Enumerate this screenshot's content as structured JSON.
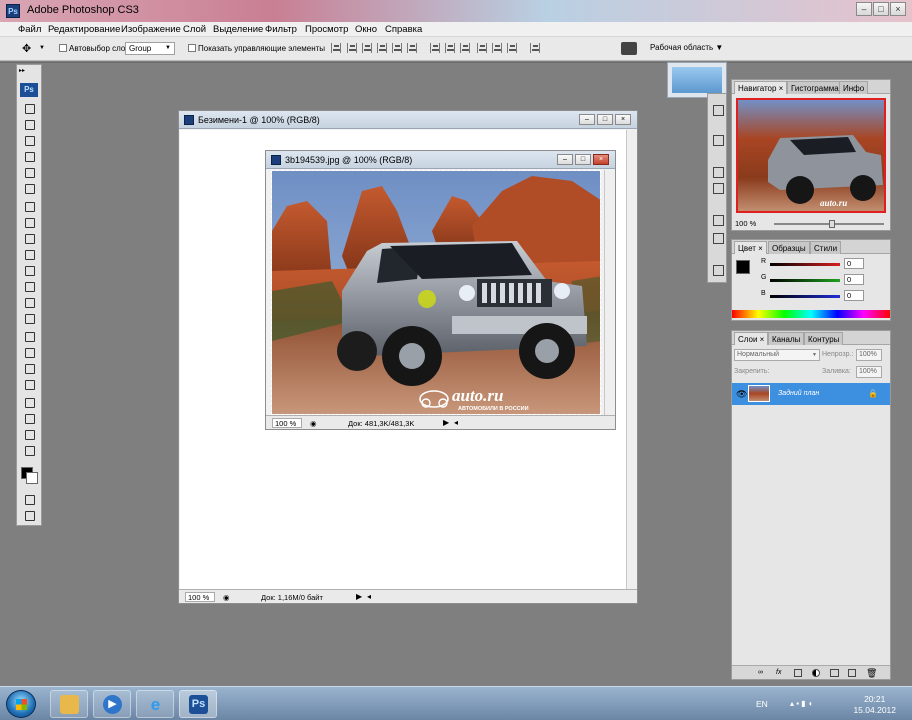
{
  "app": {
    "title": "Adobe Photoshop CS3",
    "icon_label": "Ps"
  },
  "menu": [
    "Файл",
    "Редактирование",
    "Изображение",
    "Слой",
    "Выделение",
    "Фильтр",
    "Просмотр",
    "Окно",
    "Справка"
  ],
  "options_bar": {
    "auto_select_label": "Автовыбор слоя",
    "auto_select_value": "Group",
    "show_controls_label": "Показать управляющие элементы",
    "workspace_label": "Рабочая область ▼"
  },
  "toolbox": {
    "logo": "Ps"
  },
  "doc_back": {
    "title": "Безимени-1 @ 100% (RGB/8)",
    "zoom": "100 %",
    "doc_info": "Док: 1,16M/0 байт"
  },
  "doc_front": {
    "title": "3b194539.jpg @ 100% (RGB/8)",
    "zoom": "100 %",
    "doc_info": "Док: 481,3K/481,3K",
    "watermark_main": "auto.ru",
    "watermark_sub": "АВТОМОБИЛИ В РОССИИ"
  },
  "navigator": {
    "tabs": [
      "Навигатор",
      "Гистограмма",
      "Инфо"
    ],
    "zoom": "100 %",
    "watermark": "auto.ru"
  },
  "color_panel": {
    "tabs": [
      "Цвет",
      "Образцы",
      "Стили"
    ],
    "channels": [
      {
        "name": "R",
        "value": "0",
        "color": "#d61f1f"
      },
      {
        "name": "G",
        "value": "0",
        "color": "#1fa11f"
      },
      {
        "name": "B",
        "value": "0",
        "color": "#1f2fd6"
      }
    ]
  },
  "layers_panel": {
    "tabs": [
      "Слои",
      "Каналы",
      "Контуры"
    ],
    "blend_mode": "Нормальный",
    "opacity_label": "Непрозр.:",
    "opacity_value": "100%",
    "lock_label": "Закрепить:",
    "fill_label": "Заливка:",
    "fill_value": "100%",
    "layers": [
      {
        "name": "Задний план",
        "selected": true
      }
    ]
  },
  "taskbar": {
    "language": "EN",
    "time": "20:21",
    "date": "15.04.2012",
    "ps_label": "Ps"
  },
  "colors": {
    "selection_blue": "#3d8fe0",
    "ps_blue": "#1d4f96"
  }
}
